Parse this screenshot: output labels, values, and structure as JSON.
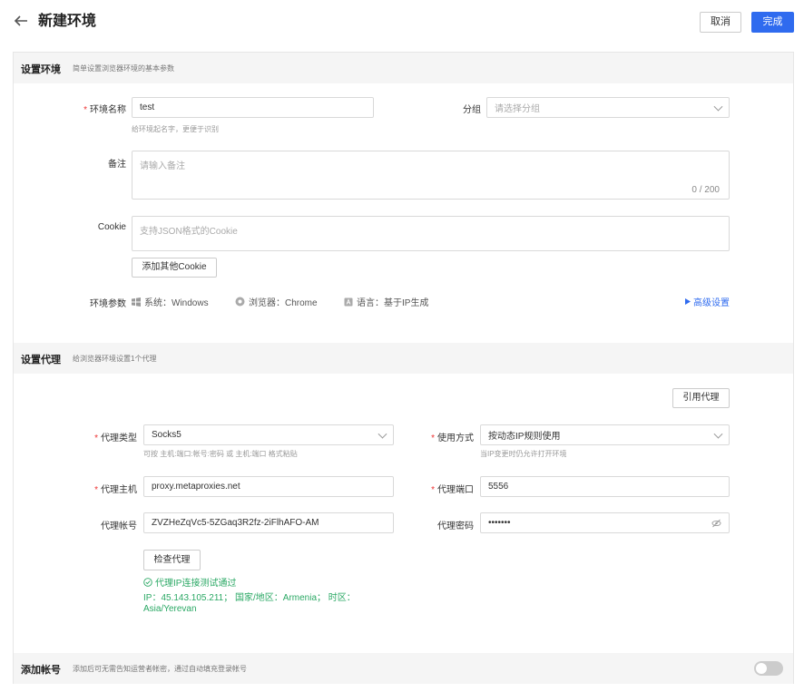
{
  "header": {
    "title": "新建环境",
    "cancel_label": "取消",
    "done_label": "完成"
  },
  "basic": {
    "title": "设置环境",
    "subtitle": "简单设置浏览器环境的基本参数",
    "name_label": "环境名称",
    "name_value": "test",
    "name_hint": "给环境起名字，更便于识别",
    "group_label": "分组",
    "group_placeholder": "请选择分组",
    "note_label": "备注",
    "note_placeholder": "请输入备注",
    "note_counter": "0 / 200",
    "cookie_label": "Cookie",
    "cookie_placeholder": "支持JSON格式的Cookie",
    "add_cookie_label": "添加其他Cookie",
    "env_params_label": "环境参数",
    "system_text": "系统：Windows",
    "browser_text": "浏览器：Chrome",
    "language_text": "语言：基于IP生成",
    "advanced_label": "高级设置"
  },
  "proxy": {
    "title": "设置代理",
    "subtitle": "给浏览器环境设置1个代理",
    "ref_proxy_label": "引用代理",
    "type_label": "代理类型",
    "type_value": "Socks5",
    "type_hint": "可按 主机:端口:帐号:密码 或 主机:端口 格式粘贴",
    "usage_label": "使用方式",
    "usage_value": "按动态IP规则使用",
    "usage_hint": "当IP变更时仍允许打开环境",
    "host_label": "代理主机",
    "host_value": "proxy.metaproxies.net",
    "port_label": "代理端口",
    "port_value": "5556",
    "account_label": "代理帐号",
    "account_value": "ZVZHeZqVc5-5ZGaq3R2fz-2iFlhAFO-AM",
    "password_label": "代理密码",
    "password_value": "•••••••",
    "check_label": "检查代理",
    "check_result": "代理IP连接测试通过",
    "check_detail_1": "IP：45.143.105.211； 国家/地区：Armenia； 时区：",
    "check_detail_2": "Asia/Yerevan"
  },
  "account": {
    "title": "添加帐号",
    "subtitle": "添加后可无需告知运营者帐密，通过自动填充登录帐号",
    "toggle_on": false
  },
  "colors": {
    "primary": "#2f6bef",
    "success": "#2aa864",
    "required": "#e33333"
  }
}
